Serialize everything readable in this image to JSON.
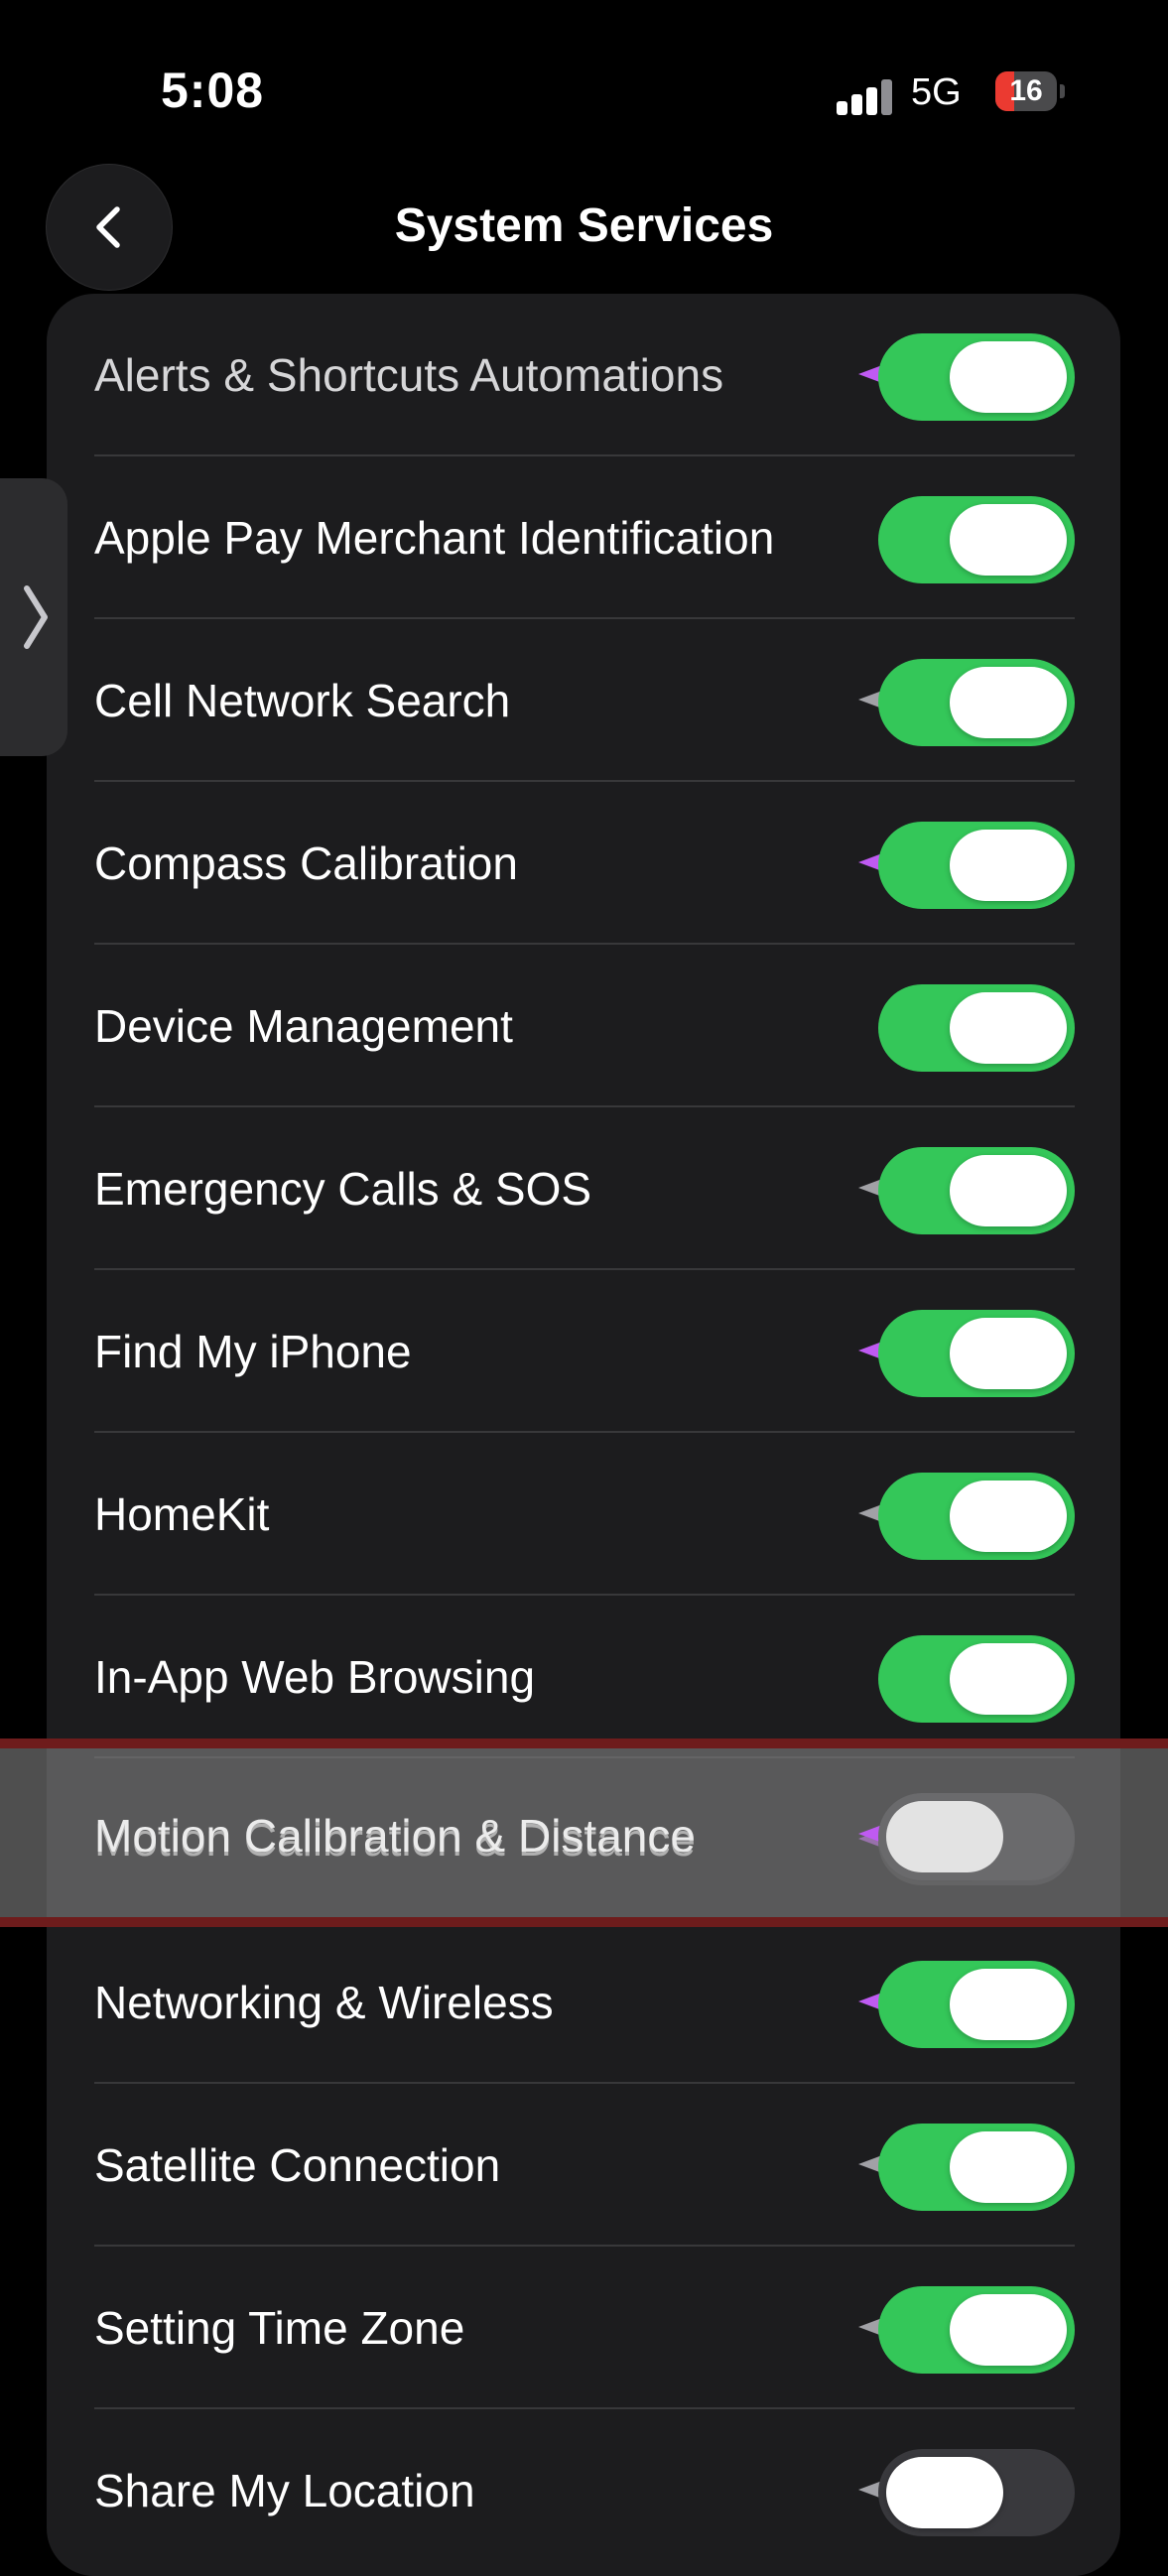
{
  "status_bar": {
    "time": "5:08",
    "network": "5G",
    "battery_level": "16",
    "battery_color": "#eb3a31"
  },
  "nav": {
    "back_icon": "chevron-left-icon",
    "title": "System Services"
  },
  "side_handle_icon": "chevron-right-icon",
  "colors": {
    "toggle_on": "#34c759",
    "toggle_off": "#39393d",
    "location_active": "#bf5af2",
    "location_recent": "#a1a1a6"
  },
  "services": [
    {
      "label": "Alerts & Shortcuts Automations",
      "enabled": true,
      "location_indicator": "purple"
    },
    {
      "label": "Apple Pay Merchant Identification",
      "enabled": true,
      "location_indicator": "none"
    },
    {
      "label": "Cell Network Search",
      "enabled": true,
      "location_indicator": "gray"
    },
    {
      "label": "Compass Calibration",
      "enabled": true,
      "location_indicator": "purple"
    },
    {
      "label": "Device Management",
      "enabled": true,
      "location_indicator": "none"
    },
    {
      "label": "Emergency Calls & SOS",
      "enabled": true,
      "location_indicator": "gray"
    },
    {
      "label": "Find My iPhone",
      "enabled": true,
      "location_indicator": "purple"
    },
    {
      "label": "HomeKit",
      "enabled": true,
      "location_indicator": "gray"
    },
    {
      "label": "In-App Web Browsing",
      "enabled": true,
      "location_indicator": "none"
    },
    {
      "label": "Motion Calibration & Distance",
      "enabled": false,
      "location_indicator": "purple",
      "highlighted": true
    },
    {
      "label": "Networking & Wireless",
      "enabled": true,
      "location_indicator": "purple"
    },
    {
      "label": "Satellite Connection",
      "enabled": true,
      "location_indicator": "gray"
    },
    {
      "label": "Setting Time Zone",
      "enabled": true,
      "location_indicator": "gray"
    },
    {
      "label": "Share My Location",
      "enabled": false,
      "location_indicator": "gray"
    }
  ]
}
